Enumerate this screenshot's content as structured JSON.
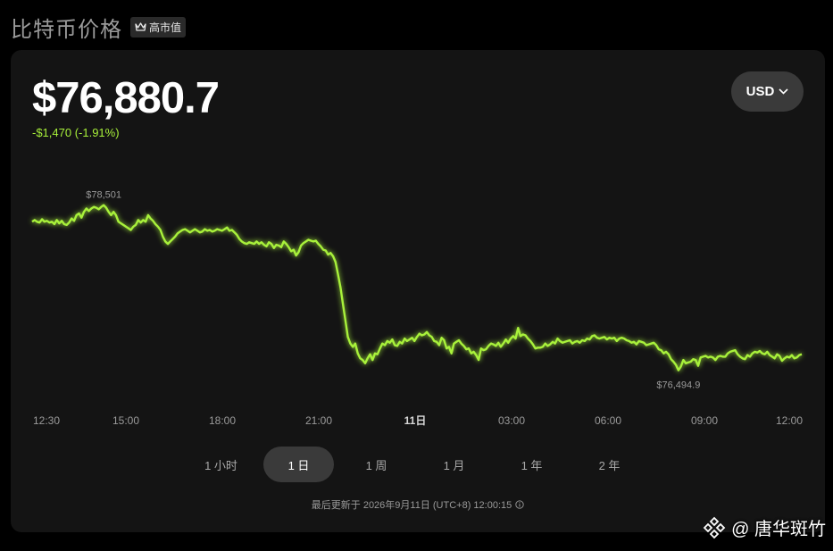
{
  "header": {
    "title": "比特币价格",
    "badge": "高市值"
  },
  "price": {
    "value": "$76,880.7",
    "change": "-$1,470 (-1.91%)"
  },
  "currency": {
    "selected": "USD"
  },
  "chart_data": {
    "type": "line",
    "series": [
      {
        "values": [
          78300,
          78320,
          78300,
          78290,
          78330,
          78300,
          78310,
          78290,
          78300,
          78270,
          78320,
          78280,
          78310,
          78270,
          78260,
          78290,
          78340,
          78310,
          78380,
          78400,
          78350,
          78420,
          78460,
          78430,
          78460,
          78480,
          78470,
          78450,
          78480,
          78501,
          78470,
          78420,
          78380,
          78420,
          78380,
          78300,
          78280,
          78260,
          78240,
          78220,
          78200,
          78240,
          78260,
          78320,
          78290,
          78320,
          78300,
          78380,
          78340,
          78310,
          78270,
          78240,
          78200,
          78120,
          78060,
          78030,
          78060,
          78090,
          78120,
          78160,
          78180,
          78200,
          78210,
          78190,
          78170,
          78190,
          78210,
          78190,
          78170,
          78180,
          78210,
          78190,
          78200,
          78180,
          78190,
          78210,
          78200,
          78190,
          78210,
          78230,
          78190,
          78200,
          78170,
          78140,
          78090,
          78060,
          78040,
          78030,
          78050,
          78040,
          78030,
          78060,
          78030,
          78050,
          78020,
          78000,
          78050,
          78030,
          77980,
          78020,
          78010,
          77990,
          78060,
          78030,
          77990,
          77940,
          77960,
          77890,
          77930,
          78010,
          78040,
          78060,
          78080,
          78070,
          78060,
          78070,
          78030,
          78000,
          77960,
          77950,
          77900,
          77920,
          77880,
          77810,
          77660,
          77500,
          77300,
          77100,
          76900,
          76820,
          76780,
          76820,
          76700,
          76640,
          76620,
          76580,
          76640,
          76690,
          76620,
          76700,
          76690,
          76760,
          76820,
          76800,
          76850,
          76830,
          76870,
          76800,
          76790,
          76840,
          76820,
          76880,
          76850,
          76870,
          76890,
          76850,
          76900,
          76940,
          76920,
          76930,
          76960,
          76920,
          76900,
          76850,
          76840,
          76800,
          76890,
          76860,
          76760,
          76780,
          76700,
          76820,
          76840,
          76860,
          76820,
          76790,
          76750,
          76760,
          76700,
          76720,
          76680,
          76620,
          76760,
          76740,
          76750,
          76790,
          76820,
          76810,
          76790,
          76830,
          76780,
          76820,
          76870,
          76830,
          76880,
          76910,
          76880,
          77010,
          76910,
          76930,
          76920,
          76880,
          76850,
          76810,
          76760,
          76770,
          76770,
          76780,
          76820,
          76790,
          76810,
          76840,
          76820,
          76880,
          76850,
          76830,
          76840,
          76850,
          76860,
          76820,
          76840,
          76850,
          76830,
          76860,
          76850,
          76880,
          76870,
          76910,
          76920,
          76890,
          76880,
          76890,
          76900,
          76870,
          76890,
          76880,
          76890,
          76850,
          76880,
          76890,
          76880,
          76860,
          76850,
          76830,
          76840,
          76810,
          76850,
          76840,
          76830,
          76800,
          76810,
          76820,
          76830,
          76800,
          76750,
          76740,
          76700,
          76720,
          76690,
          76630,
          76600,
          76560,
          76494.9,
          76540,
          76620,
          76580,
          76590,
          76600,
          76630,
          76620,
          76550,
          76650,
          76660,
          76670,
          76650,
          76660,
          76650,
          76620,
          76660,
          76670,
          76660,
          76660,
          76700,
          76720,
          76730,
          76740,
          76690,
          76660,
          76640,
          76630,
          76680,
          76660,
          76700,
          76720,
          76710,
          76730,
          76700,
          76690,
          76720,
          76680,
          76660,
          76640,
          76690,
          76670,
          76610,
          76640,
          76660,
          76650,
          76680,
          76640,
          76650,
          76680,
          76690
        ]
      }
    ],
    "x_ticks": [
      "12:30",
      "15:00",
      "18:00",
      "21:00",
      "11日",
      "03:00",
      "06:00",
      "09:00",
      "12:00"
    ],
    "annotations": [
      {
        "label": "$78,501",
        "value": 78501
      },
      {
        "label": "$76,494.9",
        "value": 76494.9
      }
    ],
    "ylim": [
      76350,
      78650
    ],
    "grid": false,
    "color": "#a8f13a"
  },
  "tabs": [
    {
      "label": "1 小时",
      "active": false
    },
    {
      "label": "1 日",
      "active": true
    },
    {
      "label": "1 周",
      "active": false
    },
    {
      "label": "1 月",
      "active": false
    },
    {
      "label": "1 年",
      "active": false
    },
    {
      "label": "2 年",
      "active": false
    }
  ],
  "footer": {
    "updated": "最后更新于 2026年9月11日 (UTC+8) 12:00:15"
  },
  "watermark": {
    "text": "@ 唐华斑竹"
  }
}
